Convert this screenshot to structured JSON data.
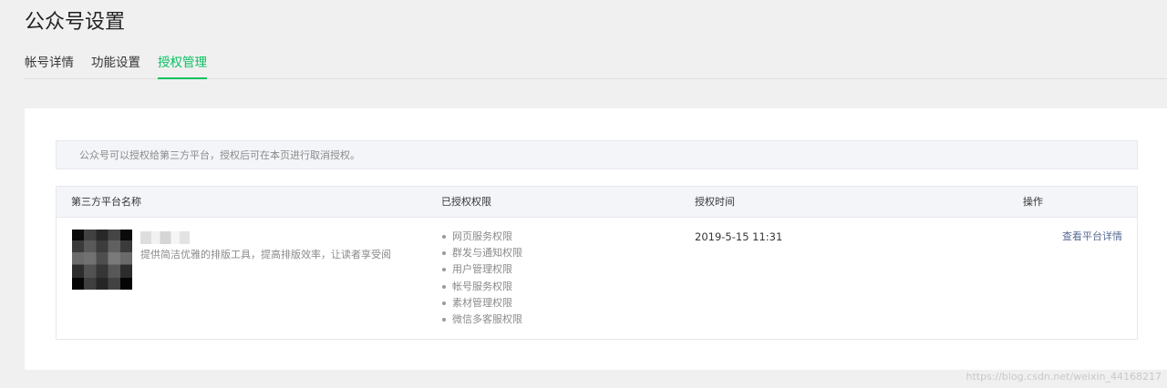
{
  "header": {
    "title": "公众号设置"
  },
  "tabs": [
    {
      "label": "帐号详情",
      "active": false
    },
    {
      "label": "功能设置",
      "active": false
    },
    {
      "label": "授权管理",
      "active": true
    }
  ],
  "notice": {
    "text": "公众号可以授权给第三方平台，授权后可在本页进行取消授权。"
  },
  "table": {
    "columns": [
      "第三方平台名称",
      "已授权权限",
      "授权时间",
      "操作"
    ],
    "rows": [
      {
        "platform_description": "提供简洁优雅的排版工具，提高排版效率，让读者享受阅",
        "permissions": [
          "网页服务权限",
          "群发与通知权限",
          "用户管理权限",
          "帐号服务权限",
          "素材管理权限",
          "微信多客服权限"
        ],
        "auth_time": "2019-5-15 11:31",
        "action_label": "查看平台详情"
      }
    ]
  },
  "watermark": "https://blog.csdn.net/weixin_44168217",
  "colors": {
    "accent": "#07c160",
    "link": "#576b95",
    "background": "#f0f0f0",
    "panel": "#f4f5f9"
  }
}
